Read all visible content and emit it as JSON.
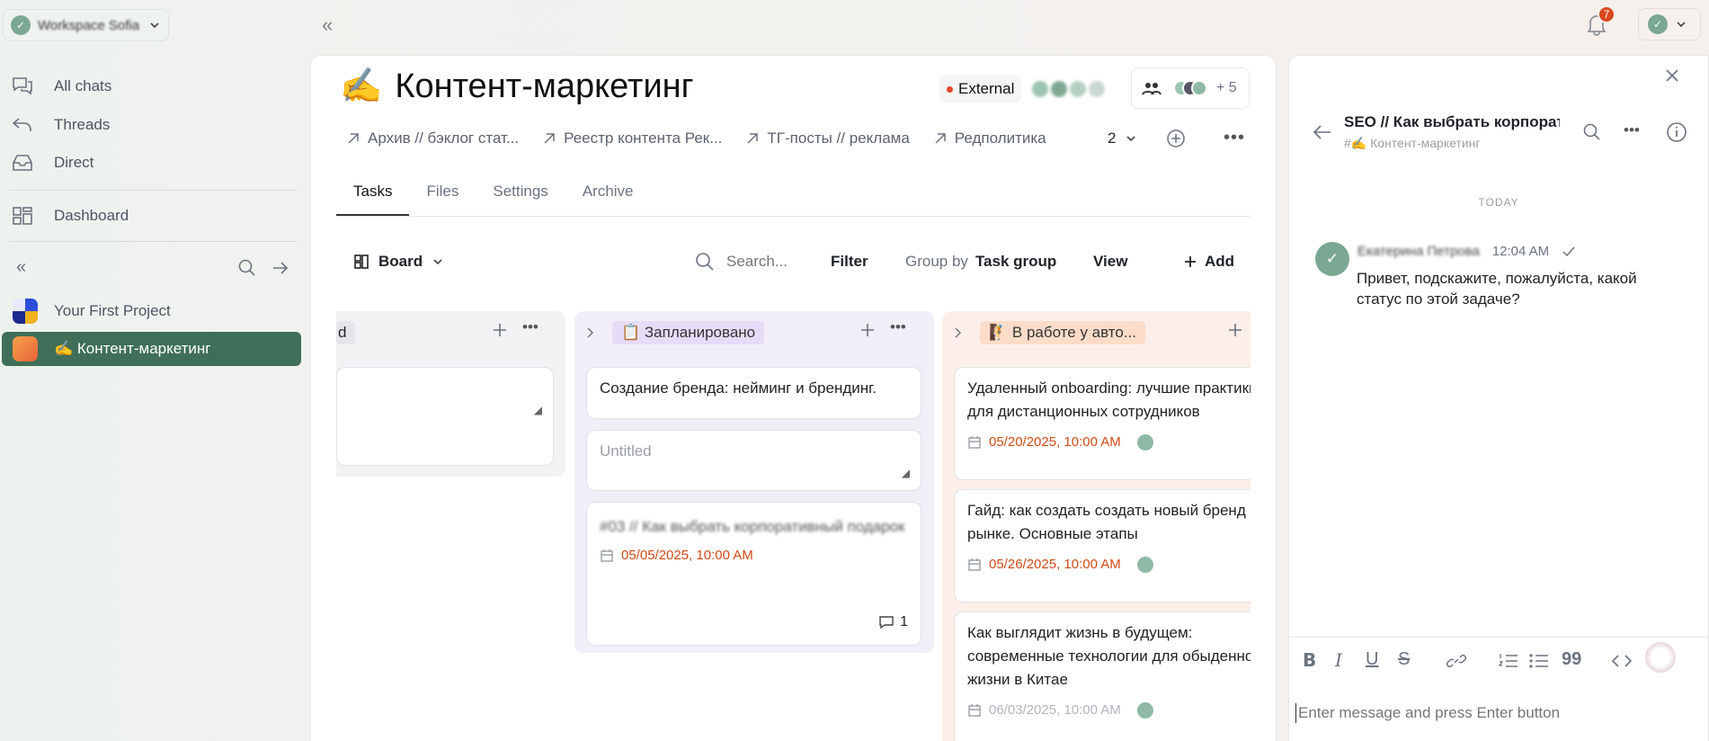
{
  "workspace": {
    "name": "Workspace Sofia"
  },
  "notifications": {
    "count": "7"
  },
  "sidebar": {
    "items": [
      {
        "label": "All chats"
      },
      {
        "label": "Threads"
      },
      {
        "label": "Direct"
      },
      {
        "label": "Dashboard"
      }
    ],
    "projects": [
      {
        "label": "Your First Project"
      },
      {
        "label": "✍️ Контент-маркетинг"
      }
    ]
  },
  "project": {
    "emoji": "✍️",
    "title": "Контент-маркетинг",
    "external_label": "External",
    "members_more": "+ 5",
    "links": [
      {
        "label": "Архив // бэклог стат..."
      },
      {
        "label": "Реестр контента Рек..."
      },
      {
        "label": "ТГ-посты // реклама"
      },
      {
        "label": "Редполитика"
      }
    ],
    "links_more": "2",
    "tabs": [
      {
        "label": "Tasks"
      },
      {
        "label": "Files"
      },
      {
        "label": "Settings"
      },
      {
        "label": "Archive"
      }
    ]
  },
  "toolbar": {
    "board_label": "Board",
    "search_placeholder": "Search...",
    "filter_label": "Filter",
    "group_by_label": "Group by",
    "group_by_value": "Task group",
    "view_label": "View",
    "add_label": "Add"
  },
  "board": {
    "col1": {
      "title": "d",
      "card_placeholder": ""
    },
    "col2": {
      "title": "📋 Запланировано",
      "cards": [
        {
          "text": "Создание бренда: нейминг и брендинг."
        },
        {
          "placeholder": "Untitled"
        },
        {
          "text": "#03 // Как выбрать корпоративный подарок",
          "date": "05/05/2025, 10:00 AM",
          "comments": "1"
        }
      ]
    },
    "col3": {
      "title": "🧗 В работе у авто...",
      "cards": [
        {
          "text": "Удаленный onboarding: лучшие практики для дистанционных сотрудников",
          "date": "05/20/2025, 10:00 AM"
        },
        {
          "text": "Гайд: как создать создать новый бренд на рынке. Основные этапы",
          "date": "05/26/2025, 10:00 AM"
        },
        {
          "text": "Как выглядит жизнь в будущем: современные технологии для обыденной жизни в Китае",
          "date": "06/03/2025, 10:00 AM"
        }
      ]
    }
  },
  "thread": {
    "title": "SEO // Как выбрать корпоративный...",
    "subtitle": "#✍️ Контент-маркетинг",
    "day_label": "TODAY",
    "message": {
      "author": "Екатерина Петрова",
      "time": "12:04 AM",
      "text": "Привет, подскажите, пожалуйста, какой статус по этой задаче?"
    },
    "editor_placeholder": "Enter message and press Enter button"
  },
  "colors": {
    "accent": "#3f6f58",
    "date": "#d24a17",
    "badge": "#d9481c"
  }
}
